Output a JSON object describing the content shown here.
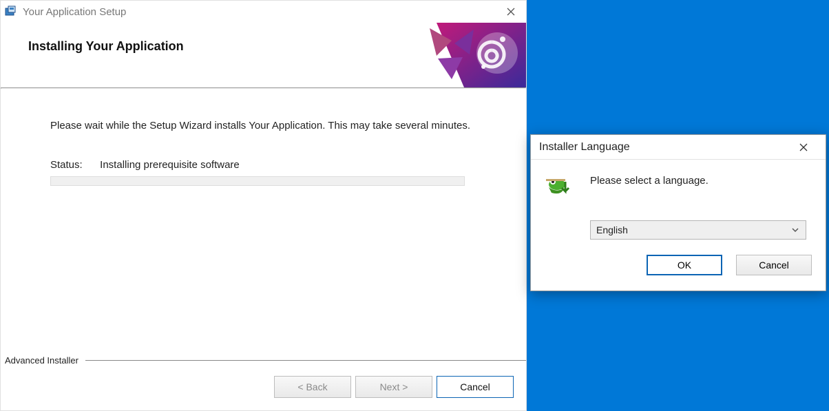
{
  "setup": {
    "window_title": "Your Application Setup",
    "heading": "Installing Your Application",
    "wait_text": "Please wait while the Setup Wizard installs Your Application.  This may take several minutes.",
    "status_label": "Status:",
    "status_value": "Installing prerequisite software",
    "brand": "Advanced Installer",
    "buttons": {
      "back": "< Back",
      "next": "Next >",
      "cancel": "Cancel"
    }
  },
  "lang_dialog": {
    "title": "Installer Language",
    "message": "Please select a language.",
    "selected": "English",
    "ok": "OK",
    "cancel": "Cancel"
  }
}
